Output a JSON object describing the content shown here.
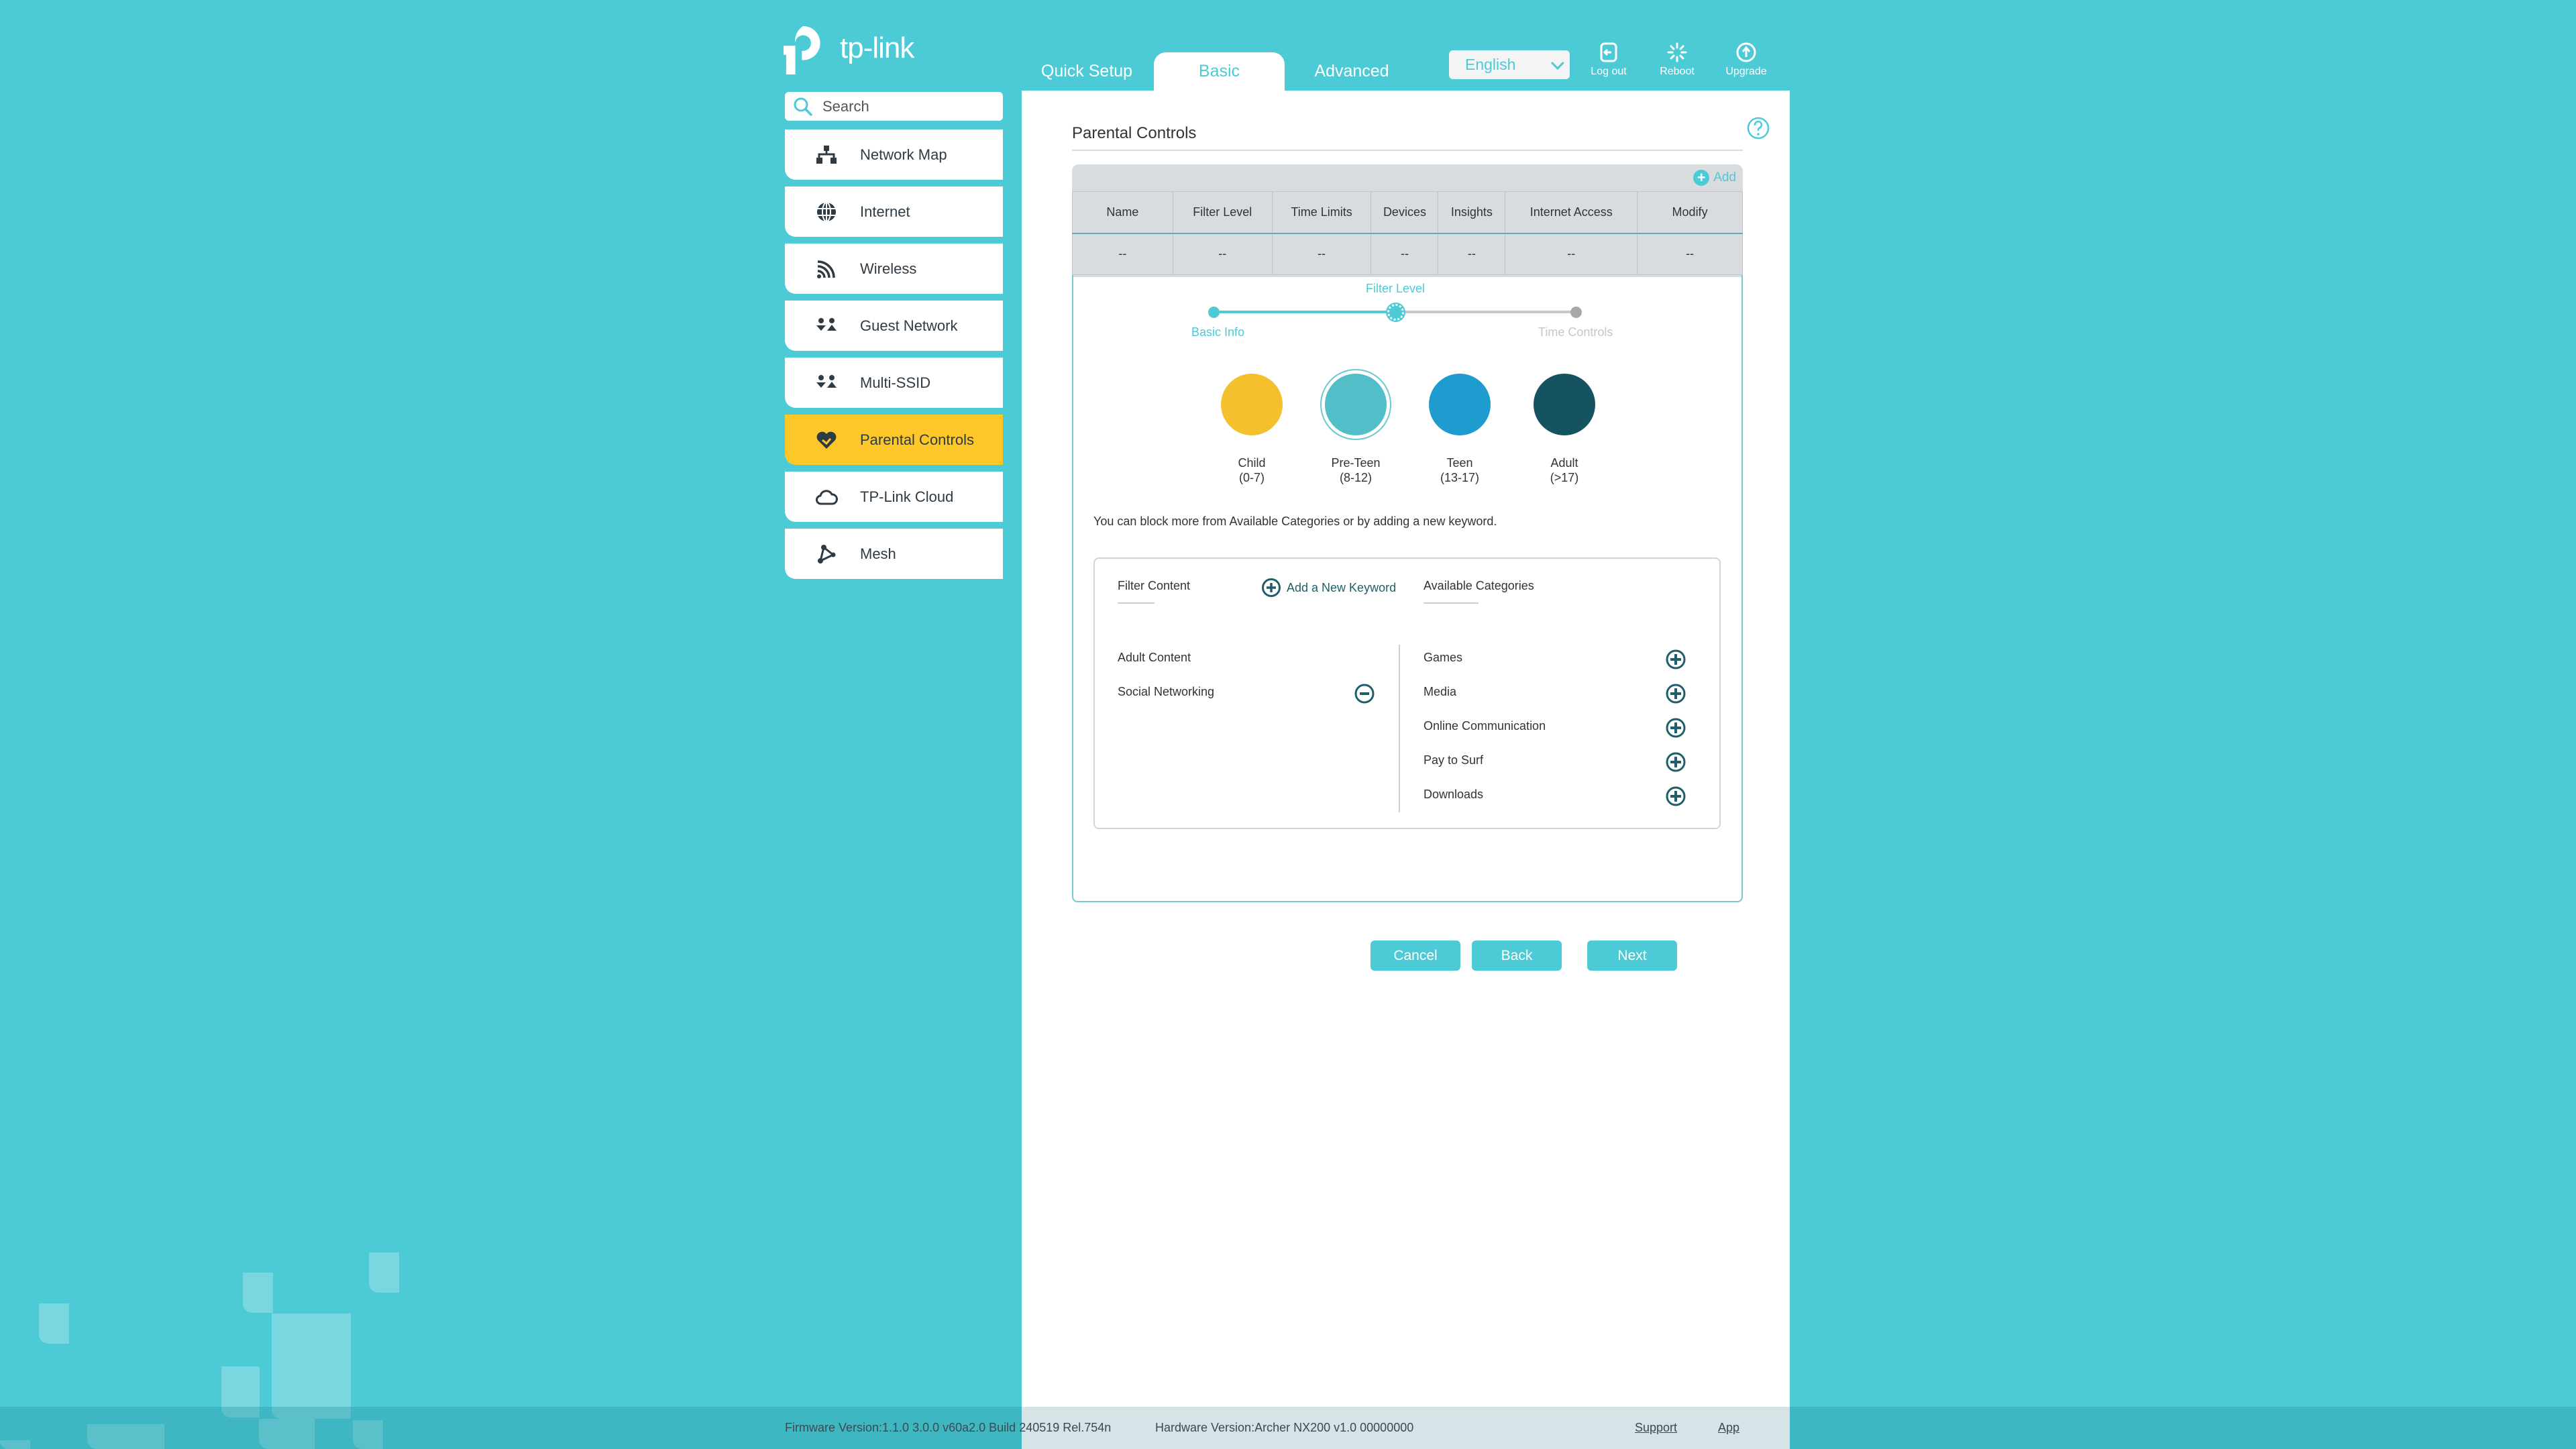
{
  "header": {
    "logo_text": "tp-link",
    "tabs": [
      {
        "label": "Quick Setup",
        "active": false
      },
      {
        "label": "Basic",
        "active": true
      },
      {
        "label": "Advanced",
        "active": false
      }
    ],
    "language": "English",
    "actions": [
      {
        "label": "Log out",
        "icon": "logout-icon"
      },
      {
        "label": "Reboot",
        "icon": "reboot-icon"
      },
      {
        "label": "Upgrade",
        "icon": "upgrade-icon"
      }
    ]
  },
  "sidebar": {
    "search_placeholder": "Search",
    "items": [
      {
        "label": "Network Map",
        "icon": "network-map-icon",
        "active": false
      },
      {
        "label": "Internet",
        "icon": "globe-icon",
        "active": false
      },
      {
        "label": "Wireless",
        "icon": "wireless-icon",
        "active": false
      },
      {
        "label": "Guest Network",
        "icon": "guest-network-icon",
        "active": false
      },
      {
        "label": "Multi-SSID",
        "icon": "multi-ssid-icon",
        "active": false
      },
      {
        "label": "Parental Controls",
        "icon": "parental-controls-icon",
        "active": true
      },
      {
        "label": "TP-Link Cloud",
        "icon": "cloud-icon",
        "active": false
      },
      {
        "label": "Mesh",
        "icon": "mesh-icon",
        "active": false
      }
    ]
  },
  "main": {
    "title": "Parental Controls",
    "add_label": "Add",
    "table": {
      "columns": [
        "Name",
        "Filter Level",
        "Time Limits",
        "Devices",
        "Insights",
        "Internet Access",
        "Modify"
      ],
      "rows": [
        [
          "--",
          "--",
          "--",
          "--",
          "--",
          "--",
          "--"
        ]
      ]
    },
    "stepper": {
      "steps": [
        {
          "label": "Basic Info",
          "state": "done"
        },
        {
          "label": "Filter Level",
          "state": "current"
        },
        {
          "label": "Time Controls",
          "state": "pending"
        }
      ]
    },
    "levels": [
      {
        "name": "Child",
        "range": "(0-7)",
        "color": "#f5c02e",
        "selected": false
      },
      {
        "name": "Pre-Teen",
        "range": "(8-12)",
        "color": "#52bfc8",
        "selected": true
      },
      {
        "name": "Teen",
        "range": "(13-17)",
        "color": "#1e9bcf",
        "selected": false
      },
      {
        "name": "Adult",
        "range": "(>17)",
        "color": "#165360",
        "selected": false
      }
    ],
    "hint": "You can block more from Available Categories or by adding a new keyword.",
    "filter_content": {
      "heading": "Filter Content",
      "add_keyword_label": "Add a New Keyword",
      "items": [
        "Adult Content",
        "Social Networking"
      ]
    },
    "available_categories": {
      "heading": "Available Categories",
      "items": [
        "Games",
        "Media",
        "Online Communication",
        "Pay to Surf",
        "Downloads"
      ]
    },
    "buttons": {
      "cancel": "Cancel",
      "back": "Back",
      "next": "Next"
    }
  },
  "footer": {
    "firmware": "Firmware Version:1.1.0 3.0.0 v60a2.0 Build 240519 Rel.754n",
    "hardware": "Hardware Version:Archer NX200 v1.0 00000000",
    "support": "Support",
    "app": "App"
  },
  "colors": {
    "brand": "#4ccad6",
    "active_menu": "#fdc72a",
    "icon_dark": "#1f5f6b"
  }
}
